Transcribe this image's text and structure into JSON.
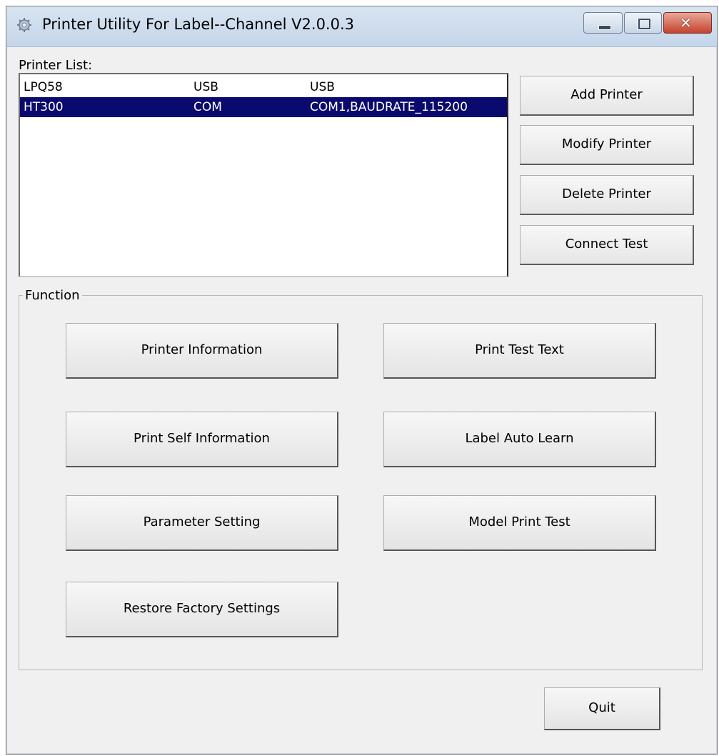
{
  "window": {
    "title": "Printer Utility For Label--Channel  V2.0.0.3",
    "icon": "gear-icon"
  },
  "printer_list": {
    "label": "Printer List:",
    "rows": [
      {
        "name": "LPQ58",
        "type": "USB",
        "port": "USB",
        "selected": false
      },
      {
        "name": "HT300",
        "type": "COM",
        "port": "COM1,BAUDRATE_115200",
        "selected": true
      }
    ]
  },
  "side_buttons": {
    "add": "Add Printer",
    "modify": "Modify Printer",
    "delete": "Delete Printer",
    "connect": "Connect Test"
  },
  "function_group": {
    "label": "Function",
    "buttons": {
      "printer_information": "Printer Information",
      "print_test_text": "Print Test Text",
      "print_self_information": "Print Self Information",
      "label_auto_learn": "Label Auto Learn",
      "parameter_setting": "Parameter Setting",
      "model_print_test": "Model Print Test",
      "restore_factory_settings": "Restore Factory Settings"
    }
  },
  "quit_label": "Quit",
  "colors": {
    "selection": "#0a0a6e",
    "window_bg": "#f0f0f0",
    "close_button": "#c4432c"
  }
}
